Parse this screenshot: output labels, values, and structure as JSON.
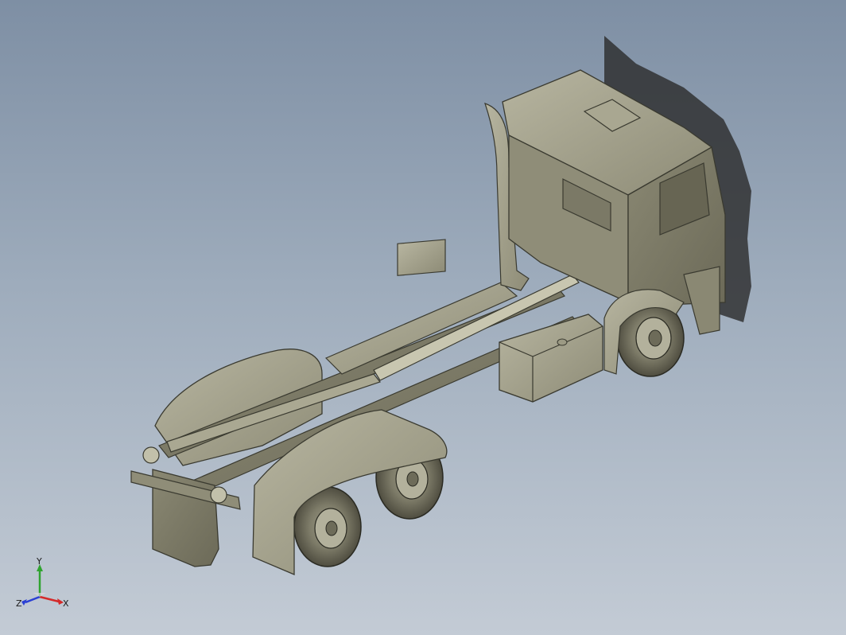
{
  "viewport": {
    "background_top": "#7e8fa4",
    "background_bottom": "#c3cbd5",
    "model_color": "#a19f89"
  },
  "triad": {
    "y_label": "Y",
    "x_label": "X",
    "z_label": "Z",
    "y_color": "#2fa32f",
    "x_color": "#d42a2a",
    "z_color": "#2a3fd4"
  }
}
